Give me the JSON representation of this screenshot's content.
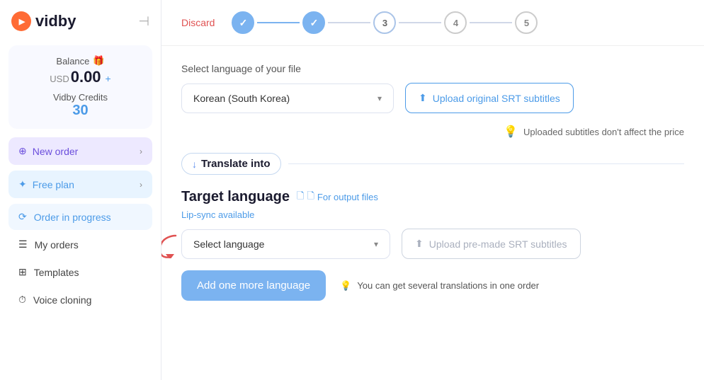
{
  "logo": {
    "name": "vidby",
    "collapse_icon": "⊣"
  },
  "sidebar": {
    "balance_label": "Balance",
    "balance_icon": "🎁",
    "currency": "USD",
    "balance_amount": "0.00",
    "add_label": "+",
    "credits_label": "Vidby Credits",
    "credits_amount": "30",
    "new_order_label": "New order",
    "free_plan_label": "Free plan",
    "nav_items": [
      {
        "id": "order-in-progress",
        "label": "Order in progress",
        "icon": "⟳",
        "active": true
      },
      {
        "id": "my-orders",
        "label": "My orders",
        "icon": "☰",
        "active": false
      },
      {
        "id": "templates",
        "label": "Templates",
        "icon": "⊞",
        "active": false
      },
      {
        "id": "voice-cloning",
        "label": "Voice cloning",
        "icon": "⏱",
        "active": false
      }
    ]
  },
  "topbar": {
    "discard_label": "Discard",
    "steps": [
      {
        "id": 1,
        "state": "done",
        "label": "✓"
      },
      {
        "id": 2,
        "state": "done",
        "label": "✓"
      },
      {
        "id": 3,
        "state": "active",
        "label": "3"
      },
      {
        "id": 4,
        "state": "default",
        "label": "4"
      },
      {
        "id": 5,
        "state": "default",
        "label": "5"
      }
    ]
  },
  "content": {
    "file_language_label": "Select language of your file",
    "selected_language": "Korean (South Korea)",
    "upload_srt_label": "Upload original SRT subtitles",
    "upload_hint": "Uploaded subtitles don't affect the price",
    "translate_into_label": "Translate into",
    "target_language_title": "Target language",
    "for_output_label": "For output files",
    "lip_sync_label": "Lip-sync available",
    "select_language_placeholder": "Select language",
    "upload_premade_label": "Upload pre-made SRT subtitles",
    "add_language_label": "Add one more language",
    "several_translations_hint": "You can get several translations in one order"
  }
}
